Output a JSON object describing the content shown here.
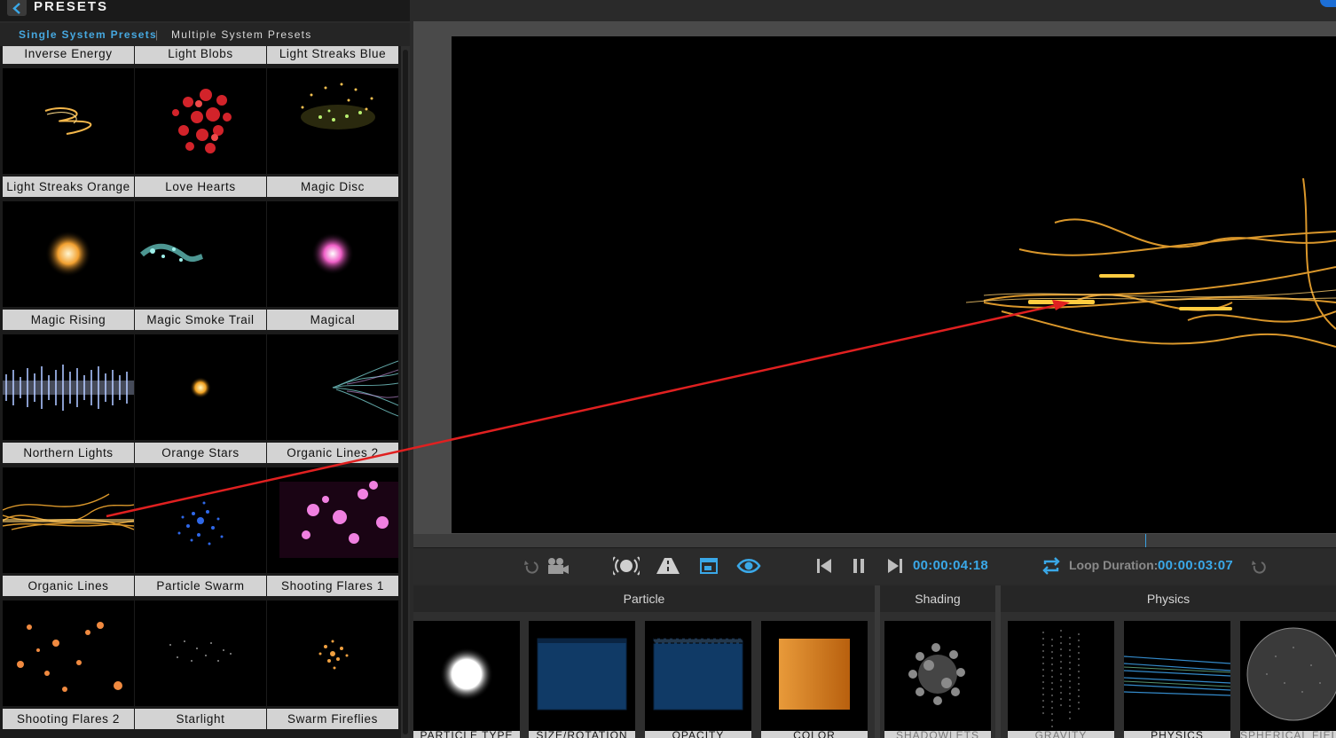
{
  "header": {
    "title": "PRESETS",
    "back_icon": "chevron-left-icon"
  },
  "tabs": {
    "single": "Single System Presets",
    "separator": "|",
    "multiple": "Multiple System Presets"
  },
  "presets": [
    "Inverse Energy",
    "Light Blobs",
    "Light Streaks Blue",
    "Light Streaks Orange",
    "Love Hearts",
    "Magic Disc",
    "Magic Rising",
    "Magic Smoke Trail",
    "Magical",
    "Northern Lights",
    "Orange Stars",
    "Organic Lines 2",
    "Organic Lines",
    "Particle Swarm",
    "Shooting Flares 1",
    "Shooting Flares 2",
    "Starlight",
    "Swarm Fireflies"
  ],
  "transport": {
    "current_time": "00:00:04:18",
    "loop_label": "Loop Duration:",
    "loop_duration": "00:00:03:07",
    "icons": [
      "undo-icon",
      "camera-icon",
      "broadcast-icon",
      "road-icon",
      "window-icon",
      "eye-icon",
      "skip-back-icon",
      "pause-icon",
      "skip-forward-icon",
      "loop-icon",
      "reset-icon"
    ]
  },
  "sections": {
    "particle": "Particle",
    "shading": "Shading",
    "physics": "Physics"
  },
  "tiles": [
    {
      "label": "PARTICLE TYPE",
      "dim": false
    },
    {
      "label": "SIZE/ROTATION",
      "dim": false
    },
    {
      "label": "OPACITY",
      "dim": false
    },
    {
      "label": "COLOR",
      "dim": false
    },
    {
      "label": "SHADOWLETS",
      "dim": true
    },
    {
      "label": "GRAVITY",
      "dim": true
    },
    {
      "label": "PHYSICS",
      "dim": false
    },
    {
      "label": "SPHERICAL FIELD",
      "dim": true
    }
  ],
  "colors": {
    "accent": "#3aa8e8",
    "annotation_arrow": "#e02020"
  }
}
